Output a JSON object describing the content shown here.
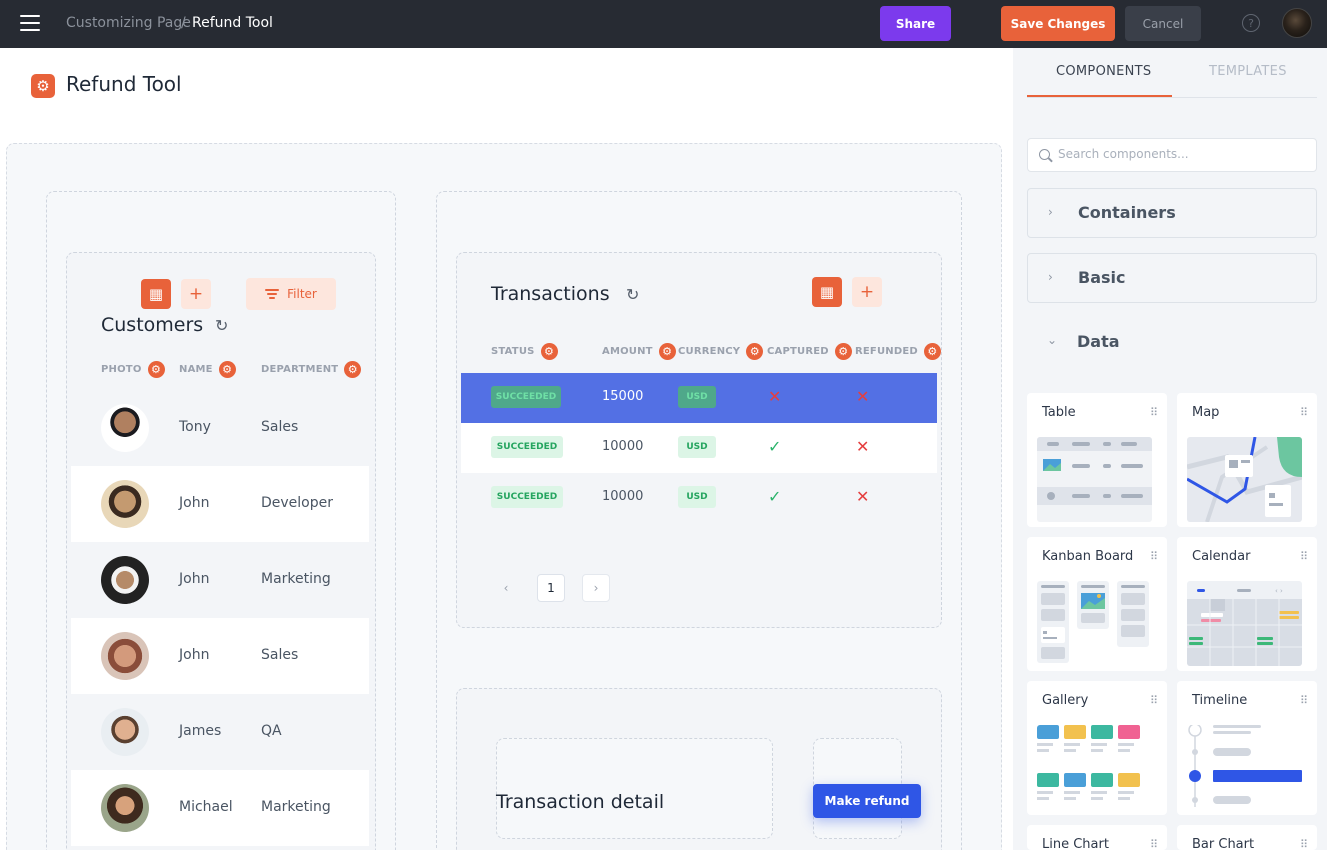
{
  "topbar": {
    "breadcrumb_parent": "Customizing Page",
    "breadcrumb_separator": "/",
    "breadcrumb_current": "Refund Tool",
    "share_label": "Share",
    "save_label": "Save Changes",
    "cancel_label": "Cancel",
    "help_glyph": "?"
  },
  "page": {
    "title": "Refund Tool"
  },
  "customers": {
    "title": "Customers",
    "filter_label": "Filter",
    "columns": [
      "PHOTO",
      "NAME",
      "DEPARTMENT"
    ],
    "rows": [
      {
        "name": "Tony",
        "department": "Sales"
      },
      {
        "name": "John",
        "department": "Developer"
      },
      {
        "name": "John",
        "department": "Marketing"
      },
      {
        "name": "John",
        "department": "Sales"
      },
      {
        "name": "James",
        "department": "QA"
      },
      {
        "name": "Michael",
        "department": "Marketing"
      }
    ]
  },
  "transactions": {
    "title": "Transactions",
    "columns": [
      "STATUS",
      "AMOUNT",
      "CURRENCY",
      "CAPTURED",
      "REFUNDED"
    ],
    "rows": [
      {
        "status": "SUCCEEDED",
        "amount": "15000",
        "currency": "USD",
        "captured": false,
        "refunded": false,
        "selected": true
      },
      {
        "status": "SUCCEEDED",
        "amount": "10000",
        "currency": "USD",
        "captured": true,
        "refunded": false,
        "selected": false
      },
      {
        "status": "SUCCEEDED",
        "amount": "10000",
        "currency": "USD",
        "captured": true,
        "refunded": false,
        "selected": false
      }
    ],
    "pagination": {
      "prev": "‹",
      "current": "1",
      "next": "›"
    }
  },
  "detail": {
    "title": "Transaction detail",
    "make_refund_label": "Make refund"
  },
  "panel": {
    "tabs": [
      {
        "label": "COMPONENTS",
        "active": true
      },
      {
        "label": "TEMPLATES",
        "active": false
      }
    ],
    "search_placeholder": "Search components...",
    "groups": [
      {
        "label": "Containers",
        "expanded": false
      },
      {
        "label": "Basic",
        "expanded": false
      },
      {
        "label": "Data",
        "expanded": true
      }
    ],
    "components": [
      "Table",
      "Map",
      "Kanban Board",
      "Calendar",
      "Gallery",
      "Timeline",
      "Line Chart",
      "Bar Chart"
    ]
  },
  "colors": {
    "accent": "#e8623a",
    "share": "#7c3aed",
    "primary_blue": "#2f56e6",
    "selected_row": "#5370e4",
    "success": "#25a55f",
    "danger": "#e53e3e"
  },
  "icons": {
    "menu": "hamburger-icon",
    "help": "help-circle-icon",
    "component": "gear-icon",
    "refresh": "refresh-icon",
    "table": "table-icon",
    "add": "plus-icon",
    "filter": "filter-icon",
    "captured_false": "cross-icon",
    "captured_true": "check-icon",
    "drag": "drag-handle-icon",
    "search": "search-icon"
  }
}
